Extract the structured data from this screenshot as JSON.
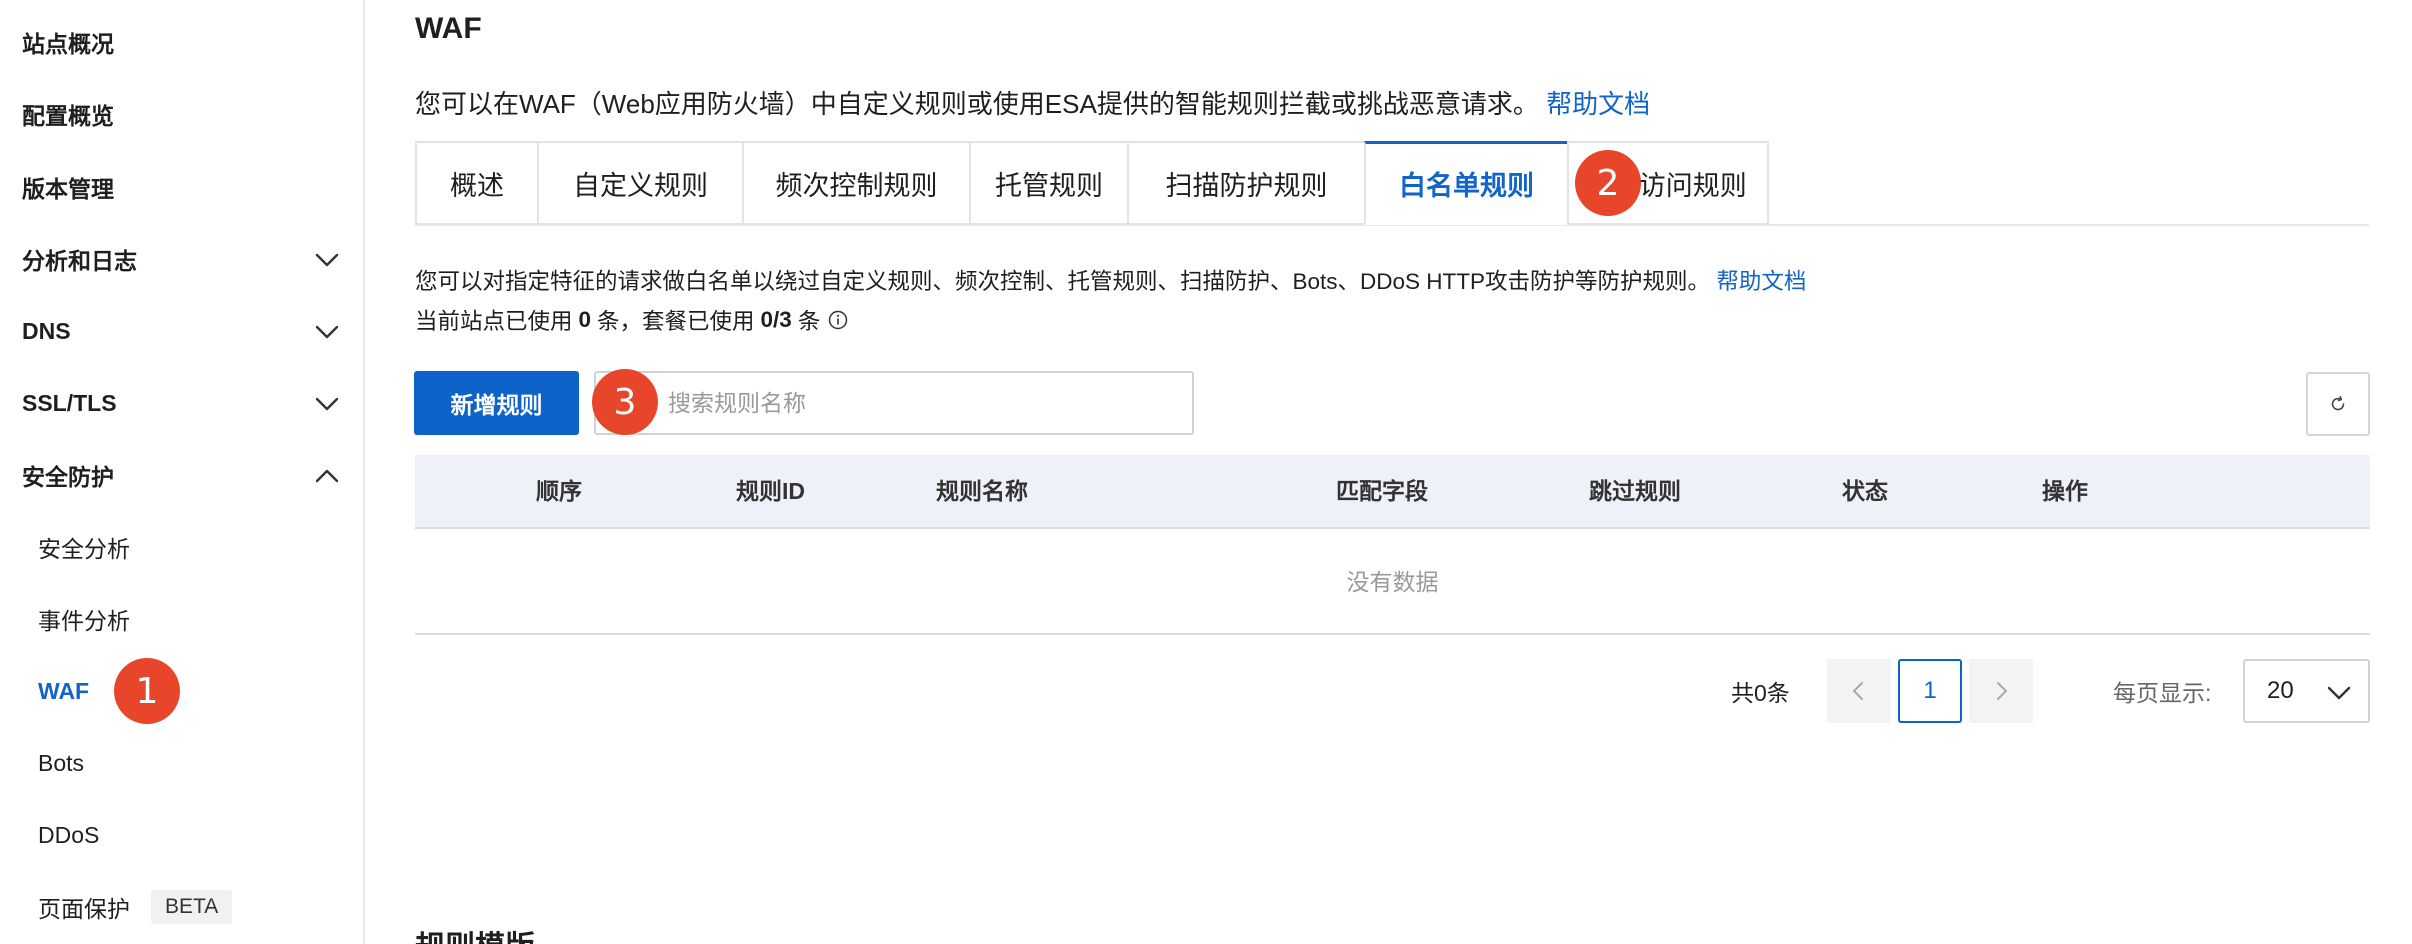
{
  "sidebar": {
    "items": [
      {
        "label": "站点概况"
      },
      {
        "label": "配置概览"
      },
      {
        "label": "版本管理"
      },
      {
        "label": "分析和日志"
      },
      {
        "label": "DNS"
      },
      {
        "label": "SSL/TLS"
      },
      {
        "label": "安全防护"
      }
    ],
    "sub_items": [
      {
        "label": "安全分析"
      },
      {
        "label": "事件分析"
      },
      {
        "label": "WAF"
      },
      {
        "label": "Bots"
      },
      {
        "label": "DDoS"
      },
      {
        "label": "页面保护",
        "tag": "BETA"
      }
    ]
  },
  "badges": [
    "1",
    "2",
    "3"
  ],
  "page": {
    "title": "WAF",
    "intro": "您可以在WAF（Web应用防火墙）中自定义规则或使用ESA提供的智能规则拦截或挑战恶意请求。",
    "help_link": "帮助文档"
  },
  "tabs": [
    {
      "label": "概述"
    },
    {
      "label": "自定义规则"
    },
    {
      "label": "频次控制规则"
    },
    {
      "label": "托管规则"
    },
    {
      "label": "扫描防护规则"
    },
    {
      "label": "白名单规则"
    },
    {
      "label": "IP访问规则"
    }
  ],
  "whitelist": {
    "description": "您可以对指定特征的请求做白名单以绕过自定义规则、频次控制、托管规则、扫描防护、Bots、DDoS HTTP攻击防护等防护规则。",
    "help_link": "帮助文档",
    "usage_prefix": "当前站点已使用",
    "usage_site": "0",
    "usage_mid": "条，套餐已使用",
    "usage_plan": "0/3",
    "usage_suffix": "条",
    "add_button": "新增规则",
    "search_placeholder": "搜索规则名称"
  },
  "table": {
    "columns": [
      "顺序",
      "规则ID",
      "规则名称",
      "匹配字段",
      "跳过规则",
      "状态",
      "操作"
    ],
    "rows": [],
    "empty_text": "没有数据"
  },
  "pagination": {
    "total_text": "共0条",
    "current_page": "1",
    "per_page_label": "每页显示:",
    "per_page_value": "20"
  },
  "bottom_heading": "规则模版",
  "colors": {
    "primary": "#0d63c9",
    "badge": "#e8462a",
    "table_header_bg": "#eef2f8"
  },
  "icons": [
    "chevron-down-icon",
    "chevron-up-icon",
    "info-icon",
    "refresh-icon",
    "chevron-left-icon",
    "chevron-right-icon"
  ]
}
